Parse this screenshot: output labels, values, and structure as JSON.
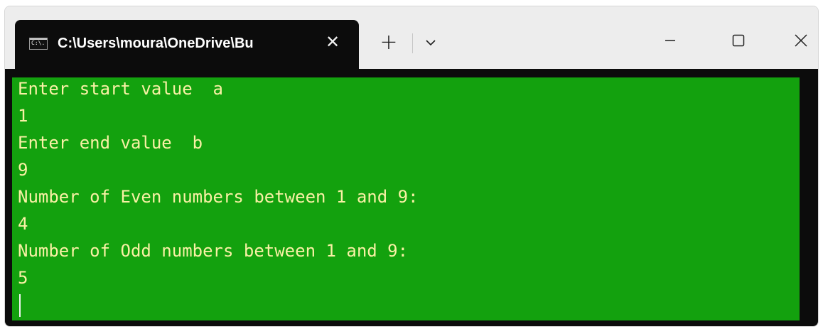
{
  "window": {
    "tab_title": "C:\\Users\\moura\\OneDrive\\Bu",
    "tab_icon": "cmd-icon",
    "tab_icon_text": "C:\\.",
    "close_tab_glyph": "✕",
    "new_tab_glyph": "+",
    "dropdown_icon": "chevron-down-icon",
    "controls": [
      "minimize-icon",
      "maximize-icon",
      "close-icon"
    ]
  },
  "console": {
    "background": "#13a10e",
    "text_color": "#f9f1a5",
    "lines": [
      "Enter start value  a",
      "1",
      "Enter end value  b",
      "9",
      "Number of Even numbers between 1 and 9:",
      "4",
      "Number of Odd numbers between 1 and 9:",
      "5"
    ]
  }
}
